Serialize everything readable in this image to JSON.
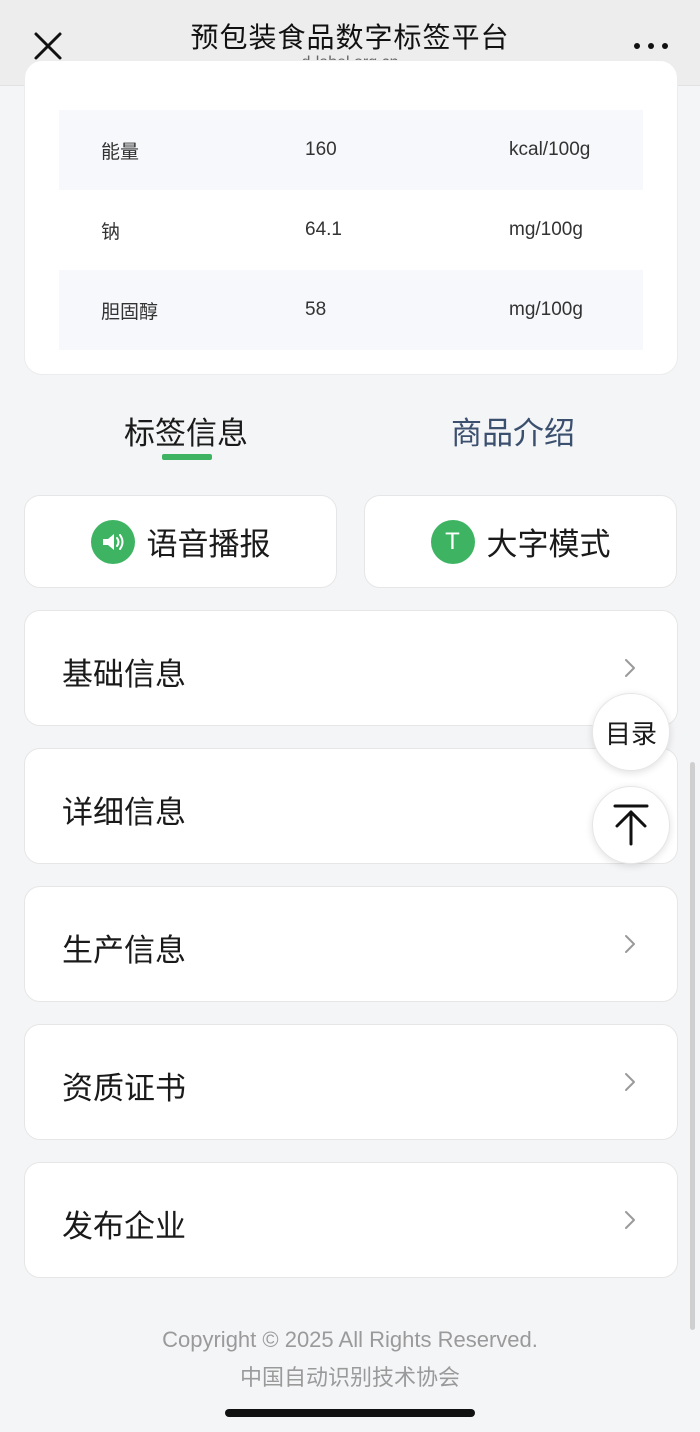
{
  "nav": {
    "title": "预包装食品数字标签平台",
    "subtitle": "d-label.org.cn"
  },
  "nutrition": {
    "rows": [
      {
        "name": "能量",
        "value": "160",
        "unit": "kcal/100g"
      },
      {
        "name": "钠",
        "value": "64.1",
        "unit": "mg/100g"
      },
      {
        "name": "胆固醇",
        "value": "58",
        "unit": "mg/100g"
      }
    ]
  },
  "tabs": {
    "active": "标签信息",
    "inactive": "商品介绍"
  },
  "functions": {
    "voice_label": "语音播报",
    "large_text_label": "大字模式",
    "large_text_icon_letter": "T"
  },
  "sections": [
    {
      "label": "基础信息"
    },
    {
      "label": "详细信息"
    },
    {
      "label": "生产信息"
    },
    {
      "label": "资质证书"
    },
    {
      "label": "发布企业"
    }
  ],
  "floating": {
    "toc_label": "目录"
  },
  "footer": {
    "copyright": "Copyright © 2025 All Rights Reserved.",
    "org": "中国自动识别技术协会"
  },
  "colors": {
    "accent": "#3eb462",
    "inactive_tab": "#3b4f6e"
  },
  "icons": {
    "close": "close-icon",
    "more": "more-icon",
    "voice": "speaker-icon",
    "large_text": "text-icon",
    "chevron": "chevron-right-icon",
    "back_to_top": "arrow-up-icon"
  }
}
